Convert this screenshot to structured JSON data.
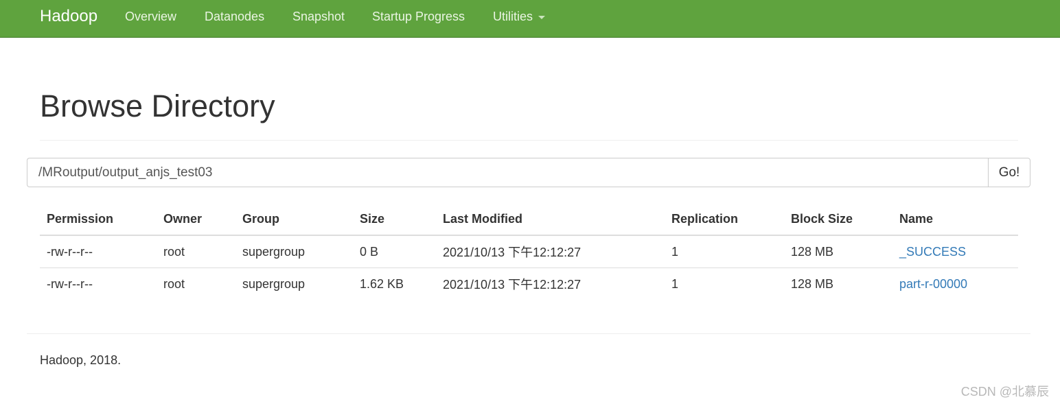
{
  "navbar": {
    "brand": "Hadoop",
    "items": [
      "Overview",
      "Datanodes",
      "Snapshot",
      "Startup Progress",
      "Utilities"
    ]
  },
  "page": {
    "title": "Browse Directory"
  },
  "path_bar": {
    "value": "/MRoutput/output_anjs_test03",
    "go_label": "Go!"
  },
  "table": {
    "headers": [
      "Permission",
      "Owner",
      "Group",
      "Size",
      "Last Modified",
      "Replication",
      "Block Size",
      "Name"
    ],
    "rows": [
      {
        "permission": "-rw-r--r--",
        "owner": "root",
        "group": "supergroup",
        "size": "0 B",
        "last_modified": "2021/10/13 下午12:12:27",
        "replication": "1",
        "block_size": "128 MB",
        "name": "_SUCCESS"
      },
      {
        "permission": "-rw-r--r--",
        "owner": "root",
        "group": "supergroup",
        "size": "1.62 KB",
        "last_modified": "2021/10/13 下午12:12:27",
        "replication": "1",
        "block_size": "128 MB",
        "name": "part-r-00000"
      }
    ]
  },
  "footer": {
    "text": "Hadoop, 2018."
  },
  "watermark": {
    "text": "CSDN @北慕辰"
  },
  "colors": {
    "navbar_bg": "#5fa33e",
    "link": "#337ab7"
  }
}
